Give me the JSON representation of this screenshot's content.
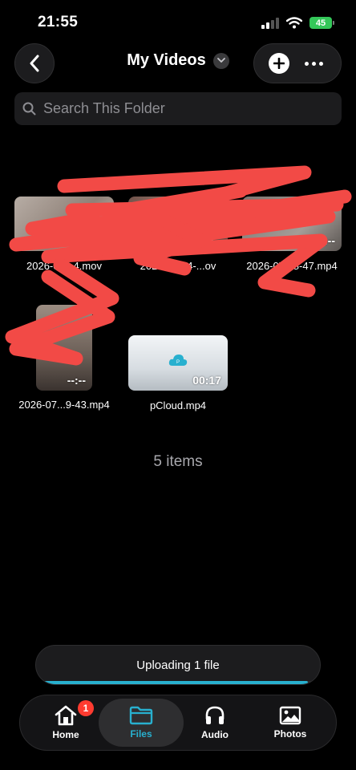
{
  "status_bar": {
    "time": "21:55",
    "battery": "45"
  },
  "header": {
    "title": "My Videos"
  },
  "search": {
    "placeholder": "Search This Folder"
  },
  "files": [
    {
      "name": "2026-07...4.mov",
      "duration": ""
    },
    {
      "name": "2026-07...4-...ov",
      "duration": "--:--"
    },
    {
      "name": "2026-07...8-47.mp4",
      "duration": "--:--"
    },
    {
      "name": "2026-07...9-43.mp4",
      "duration": "--:--"
    },
    {
      "name": "pCloud.mp4",
      "duration": "00:17"
    }
  ],
  "items_count": "5 items",
  "upload": {
    "label": "Uploading 1 file",
    "progress": 0.98
  },
  "tabs": [
    {
      "label": "Home",
      "badge": "1"
    },
    {
      "label": "Files"
    },
    {
      "label": "Audio"
    },
    {
      "label": "Photos"
    }
  ],
  "colors": {
    "accent": "#28b0cf",
    "badge": "#ff3b30",
    "scribble": "#f24a46",
    "battery": "#34c759"
  }
}
